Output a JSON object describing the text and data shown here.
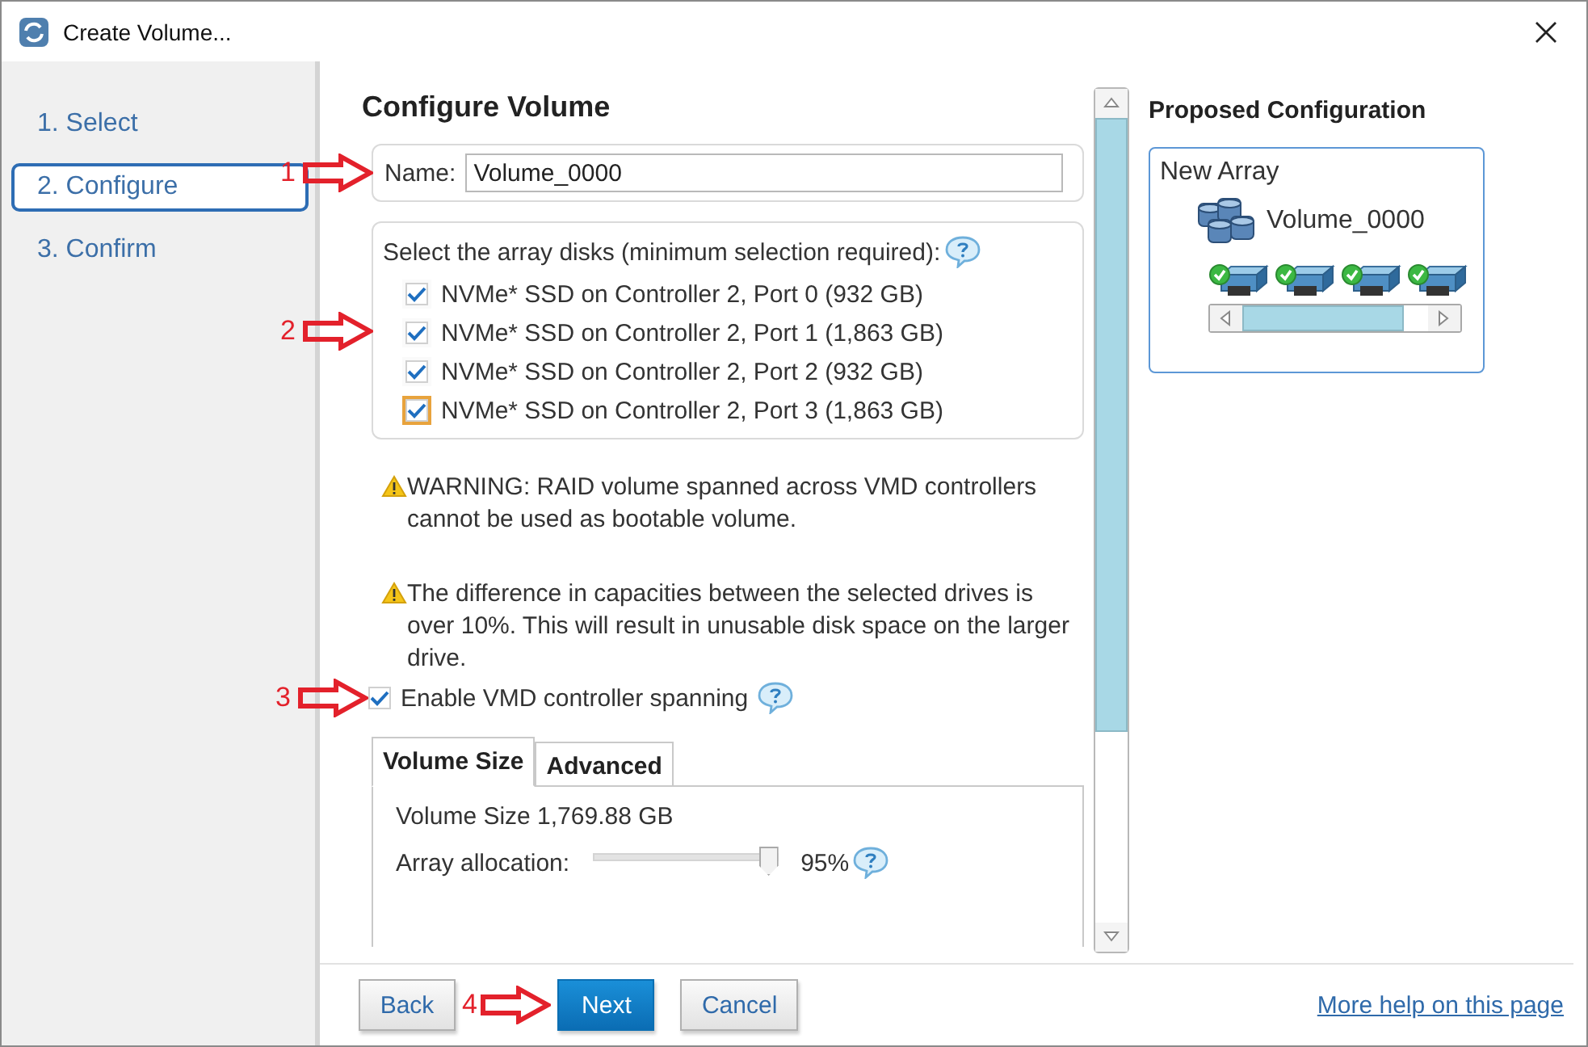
{
  "window": {
    "title": "Create Volume..."
  },
  "steps": [
    {
      "label": "1. Select",
      "selected": false
    },
    {
      "label": "2. Configure",
      "selected": true
    },
    {
      "label": "3. Confirm",
      "selected": false
    }
  ],
  "heading": "Configure Volume",
  "name_field": {
    "label": "Name:",
    "value": "Volume_0000",
    "annotation": "1"
  },
  "disks": {
    "prompt": "Select the array disks (minimum selection required):",
    "annotation": "2",
    "items": [
      {
        "label": "NVMe* SSD on Controller 2, Port 0 (932 GB)",
        "checked": true,
        "focused": false
      },
      {
        "label": "NVMe* SSD on Controller 2, Port 1 (1,863 GB)",
        "checked": true,
        "focused": false
      },
      {
        "label": "NVMe* SSD on Controller 2, Port 2 (932 GB)",
        "checked": true,
        "focused": false
      },
      {
        "label": "NVMe* SSD on Controller 2, Port 3 (1,863 GB)",
        "checked": true,
        "focused": true
      }
    ]
  },
  "warnings": [
    "WARNING: RAID volume spanned across VMD controllers cannot be used as bootable volume.",
    "The difference in capacities between the selected drives is over 10%. This will result in unusable disk space on the larger drive."
  ],
  "vmd_spanning": {
    "label": "Enable VMD controller spanning",
    "checked": true,
    "annotation": "3"
  },
  "tabs": [
    {
      "label": "Volume Size",
      "selected": true
    },
    {
      "label": "Advanced",
      "selected": false
    }
  ],
  "volume_size": {
    "label": "Volume Size 1,769.88 GB",
    "allocation_label": "Array allocation:",
    "level": 0.95,
    "reading": "95%"
  },
  "proposed": {
    "title": "Proposed Configuration",
    "array": "New Array",
    "volume": "Volume_0000"
  },
  "buttons": [
    {
      "label": "Back",
      "kind": "secondary"
    },
    {
      "label": "Next",
      "kind": "primary",
      "annotation": "4"
    },
    {
      "label": "Cancel",
      "kind": "secondary"
    }
  ],
  "help_link": "More help on this page"
}
